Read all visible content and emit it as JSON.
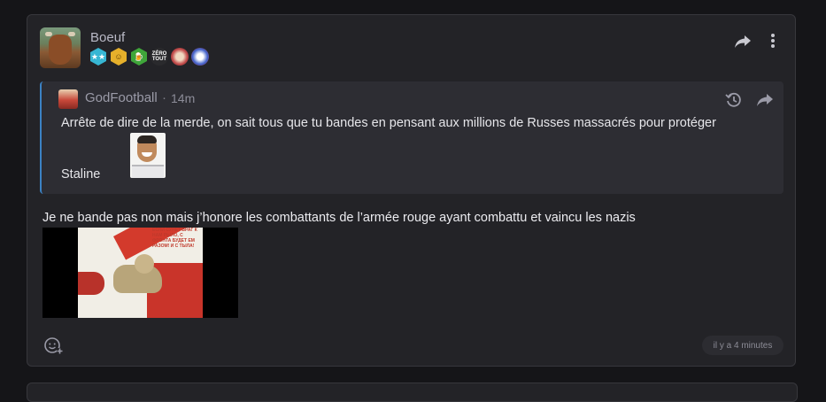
{
  "post": {
    "author": "Boeuf",
    "badges": [
      {
        "icon": "star-badge-icon",
        "label": "★★"
      },
      {
        "icon": "smiley-badge-icon",
        "label": "☺"
      },
      {
        "icon": "beer-badge-icon",
        "label": "🍺"
      },
      {
        "icon": "zero-tout-badge-icon",
        "label": "ZÉRO TOUT"
      },
      {
        "icon": "sun-badge-icon",
        "label": ""
      },
      {
        "icon": "face-badge-icon",
        "label": ""
      }
    ],
    "quote": {
      "author": "GodFootball",
      "separator": "·",
      "time": "14m",
      "text": "Arrête de dire de la merde, on sait tous que tu bandes en pensant aux millions de Russes massacrés pour protéger",
      "last_word": "Staline"
    },
    "reply_text": "Je ne bande pas non mais j’honore les combattants de l’armée rouge ayant combattu et vaincu les nazis",
    "poster_caption": "ЕСЛИ СУНЕТ ВРАГ К НАМ РЫЛО, С ФРОНТА БУДЕТ ЕМ РАЗОМ! И С ТЫЛА!",
    "timestamp": "il y a 4 minutes"
  },
  "colors": {
    "background": "#151518",
    "card": "#232327",
    "quote_bg": "#2d2d33",
    "quote_accent": "#3b82c4"
  }
}
